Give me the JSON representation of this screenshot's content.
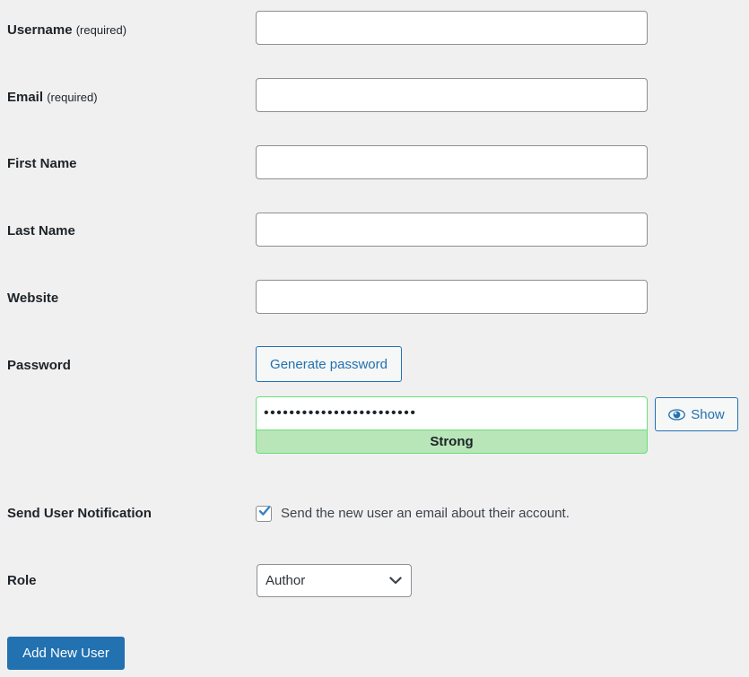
{
  "form": {
    "rows": [
      {
        "label": "Username",
        "suffix": "(required)",
        "value": "",
        "placeholder": ""
      },
      {
        "label": "Email",
        "suffix": "(required)",
        "value": "",
        "placeholder": ""
      },
      {
        "label": "First Name",
        "suffix": "",
        "value": "",
        "placeholder": ""
      },
      {
        "label": "Last Name",
        "suffix": "",
        "value": "",
        "placeholder": ""
      },
      {
        "label": "Website",
        "suffix": "",
        "value": "",
        "placeholder": ""
      }
    ],
    "password": {
      "label": "Password",
      "generate_label": "Generate password",
      "value": "••••••••••••••••••••••••",
      "strength_label": "Strong",
      "toggle_label": "Show",
      "toggle_icon": "eye-icon",
      "strength_background": "#b8e6b8",
      "strength_border": "#68de7c"
    },
    "notification": {
      "label": "Send User Notification",
      "checkbox_label": "Send the new user an email about their account.",
      "checked": true
    },
    "role": {
      "label": "Role",
      "selected": "Author",
      "arrow_icon": "chevron-down-icon"
    },
    "submit": {
      "label": "Add New User"
    }
  },
  "theme": {
    "page_background": "#f0f0f1",
    "accent": "#2271b1",
    "label_color": "#1d2327",
    "input_border": "#8c8f94"
  }
}
